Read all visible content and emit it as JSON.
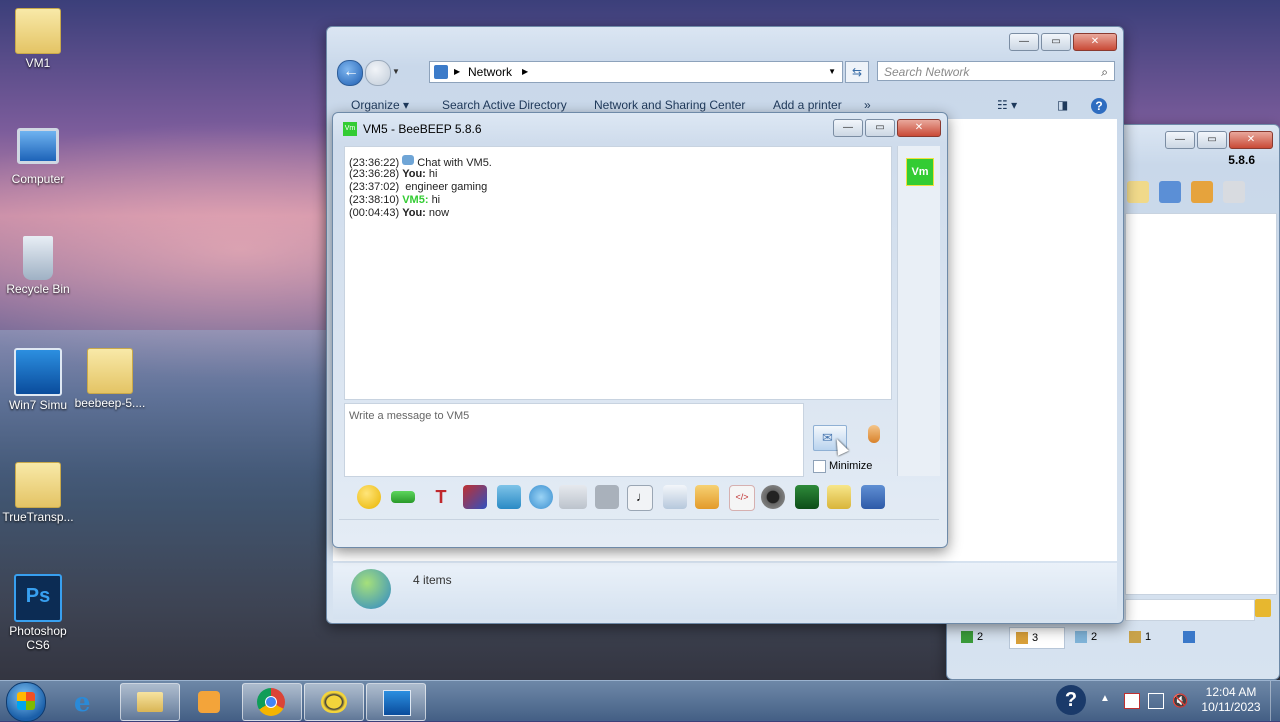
{
  "desktop": {
    "icons": [
      {
        "label": "VM1"
      },
      {
        "label": "Computer"
      },
      {
        "label": "Recycle Bin"
      },
      {
        "label": "Win7 Simu"
      },
      {
        "label": "beebeep-5...."
      },
      {
        "label": "TrueTransp..."
      },
      {
        "label": "Photoshop CS6"
      }
    ]
  },
  "explorer": {
    "address": "Network",
    "search_placeholder": "Search Network",
    "commands": [
      "Organize ▾",
      "Search Active Directory",
      "Network and Sharing Center",
      "Add a printer",
      "»"
    ],
    "status": "4 items"
  },
  "beebeep_main": {
    "version": "5.8.6",
    "tabs": [
      {
        "count": "2"
      },
      {
        "count": "3"
      },
      {
        "count": "2"
      },
      {
        "count": "1"
      }
    ]
  },
  "chat": {
    "title": "VM5 - BeeBEEP 5.8.6",
    "avatar_text": "Vm",
    "messages": [
      {
        "time": "(23:36:22)",
        "sender": "",
        "text": "Chat with VM5."
      },
      {
        "time": "(23:36:28)",
        "sender": "You:",
        "text": "hi"
      },
      {
        "time": "(23:37:02)",
        "sender": "",
        "text": "engineer gaming"
      },
      {
        "time": "(23:38:10)",
        "sender": "VM5:",
        "text": "hi"
      },
      {
        "time": "(00:04:43)",
        "sender": "You:",
        "text": "now"
      }
    ],
    "input_placeholder": "Write a message to VM5",
    "minimize_label": "Minimize",
    "colors": {
      "accent": "#33cc33",
      "you": "#000000"
    },
    "toolbar_icons": [
      "smiley-icon",
      "color-icon",
      "font-icon",
      "filter-icon",
      "compact-icon",
      "settings-icon",
      "spellcheck-icon",
      "font-size-icon",
      "sound-icon",
      "file-send-icon",
      "folder-icon",
      "html-icon",
      "screenshot-icon",
      "terminal-icon",
      "note-icon",
      "save-icon"
    ]
  },
  "tray": {
    "time": "12:04 AM",
    "date": "10/11/2023"
  }
}
